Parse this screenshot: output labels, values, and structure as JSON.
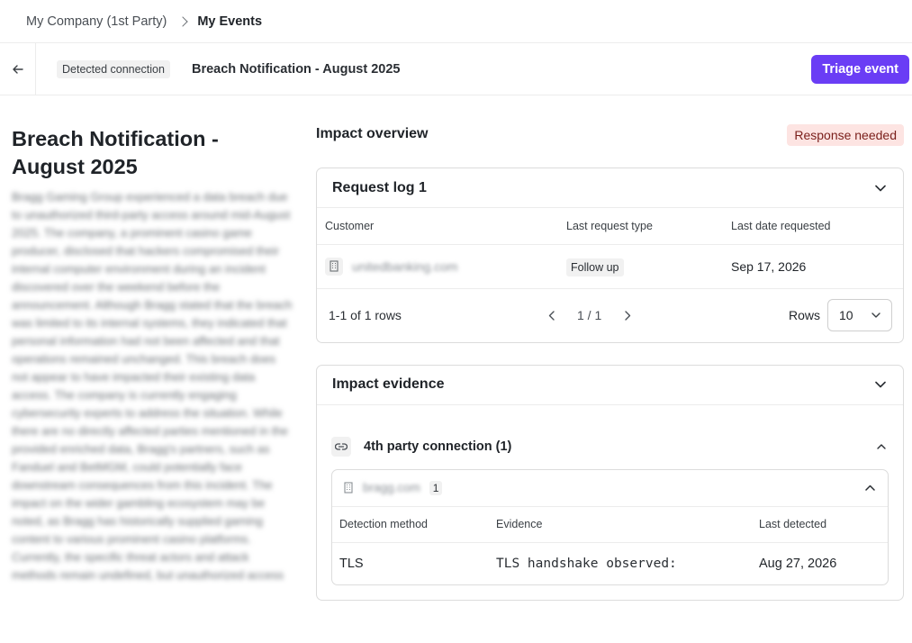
{
  "breadcrumb": {
    "parent": "My Company (1st Party)",
    "current": "My Events"
  },
  "event_header": {
    "chip": "Detected connection",
    "title": "Breach Notification - August 2025",
    "triage_button": "Triage event"
  },
  "summary": {
    "title": "Breach Notification - August 2025",
    "description": "Bragg Gaming Group experienced a data breach due to unauthorized third-party access around mid-August 2025. The company, a prominent casino game producer, disclosed that hackers compromised their internal computer environment during an incident discovered over the weekend before the announcement. Although Bragg stated that the breach was limited to its internal systems, they indicated that personal information had not been affected and that operations remained unchanged. This breach does not appear to have impacted their existing data access. The company is currently engaging cybersecurity experts to address the situation. While there are no directly affected parties mentioned in the provided enriched data, Bragg's partners, such as Fanduel and BetMGM, could potentially face downstream consequences from this incident. The impact on the wider gambling ecosystem may be noted, as Bragg has historically supplied gaming content to various prominent casino platforms. Currently, the specific threat actors and attack methods remain undefined, but unauthorized access"
  },
  "impact_overview": {
    "title": "Impact overview",
    "status_badge": "Response needed"
  },
  "request_log": {
    "title": "Request log 1",
    "columns": [
      "Customer",
      "Last request type",
      "Last date requested"
    ],
    "rows": [
      {
        "customer": "unitedbanking.com",
        "request_type": "Follow up",
        "date": "Sep 17, 2026"
      }
    ],
    "pager": {
      "rows_count": "1-1 of 1 rows",
      "page": "1 / 1",
      "rows_label": "Rows",
      "rows_value": "10"
    }
  },
  "impact_evidence": {
    "title": "Impact evidence",
    "connection_label": "4th party connection (1)",
    "vendor": {
      "domain": "bragg.com",
      "count": "1",
      "columns": [
        "Detection method",
        "Evidence",
        "Last detected"
      ],
      "rows": [
        {
          "method": "TLS",
          "evidence": "TLS handshake observed:",
          "last_detected": "Aug 27, 2026"
        }
      ]
    }
  },
  "colors": {
    "accent": "#6a3df5",
    "response_badge_bg": "#fde4e2",
    "border": "#dcdcdc"
  },
  "icons": [
    "chevron-right-icon",
    "arrow-left-icon",
    "chevron-down-icon",
    "chevron-up-icon",
    "chevron-left-icon",
    "building-icon",
    "link-icon"
  ]
}
